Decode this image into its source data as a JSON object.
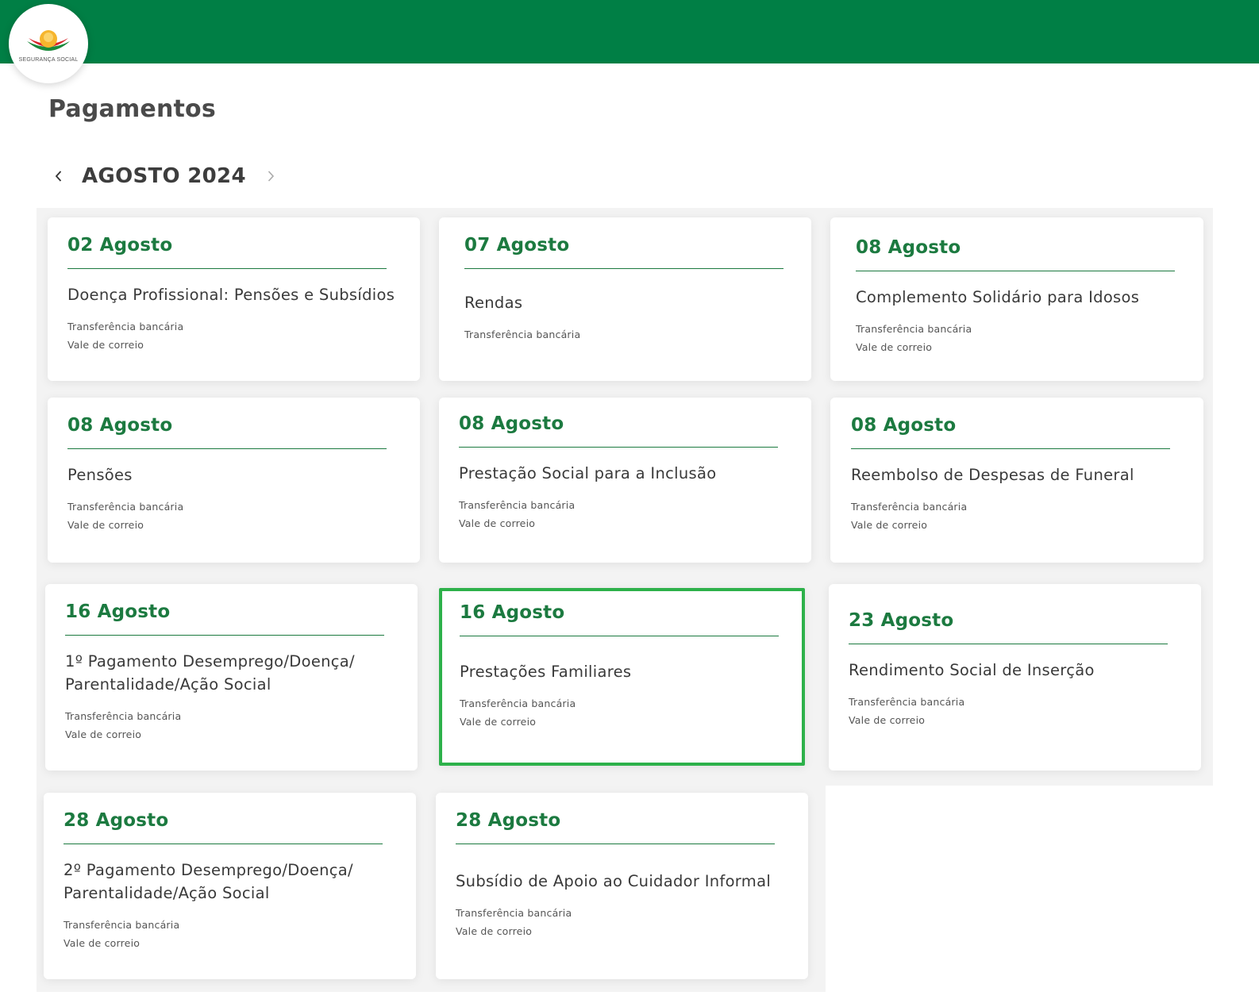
{
  "logo": {
    "text": "SEGURANÇA SOCIAL",
    "colors": {
      "sun": "#f6b52d",
      "red": "#d8262c",
      "green": "#1a8a3b"
    }
  },
  "header": {
    "bar_color": "#007f45"
  },
  "page": {
    "title": "Pagamentos"
  },
  "month_nav": {
    "label": "AGOSTO 2024",
    "prev_icon": "chevron-left-icon",
    "next_icon": "chevron-right-icon"
  },
  "colors": {
    "accent": "#1c7a40",
    "selected_border": "#2db14a"
  },
  "cards": [
    {
      "date": "02 Agosto",
      "title": "Doença Profissional: Pensões e Subsídios",
      "methods": [
        "Transferência bancária",
        "Vale de correio"
      ]
    },
    {
      "date": "07 Agosto",
      "title": "Rendas",
      "methods": [
        "Transferência bancária"
      ]
    },
    {
      "date": "08 Agosto",
      "title": "Complemento Solidário para Idosos",
      "methods": [
        "Transferência bancária",
        "Vale de correio"
      ]
    },
    {
      "date": "08 Agosto",
      "title": "Pensões",
      "methods": [
        "Transferência bancária",
        "Vale de correio"
      ]
    },
    {
      "date": "08 Agosto",
      "title": "Prestação Social para a Inclusão",
      "methods": [
        "Transferência bancária",
        "Vale de correio"
      ]
    },
    {
      "date": "08 Agosto",
      "title": "Reembolso de Despesas de Funeral",
      "methods": [
        "Transferência bancária",
        "Vale de correio"
      ]
    },
    {
      "date": "16 Agosto",
      "title": "1º Pagamento Desemprego/Doença/ Parentalidade/Ação Social",
      "methods": [
        "Transferência bancária",
        "Vale de correio"
      ]
    },
    {
      "date": "16 Agosto",
      "title": "Prestações Familiares",
      "methods": [
        "Transferência bancária",
        "Vale de correio"
      ],
      "selected": true
    },
    {
      "date": "23 Agosto",
      "title": "Rendimento Social de Inserção",
      "methods": [
        "Transferência bancária",
        "Vale de correio"
      ]
    },
    {
      "date": "28 Agosto",
      "title": "2º Pagamento Desemprego/Doença/ Parentalidade/Ação Social",
      "methods": [
        "Transferência bancária",
        "Vale de correio"
      ]
    },
    {
      "date": "28 Agosto",
      "title": "Subsídio de Apoio ao Cuidador Informal",
      "methods": [
        "Transferência bancária",
        "Vale de correio"
      ]
    }
  ]
}
